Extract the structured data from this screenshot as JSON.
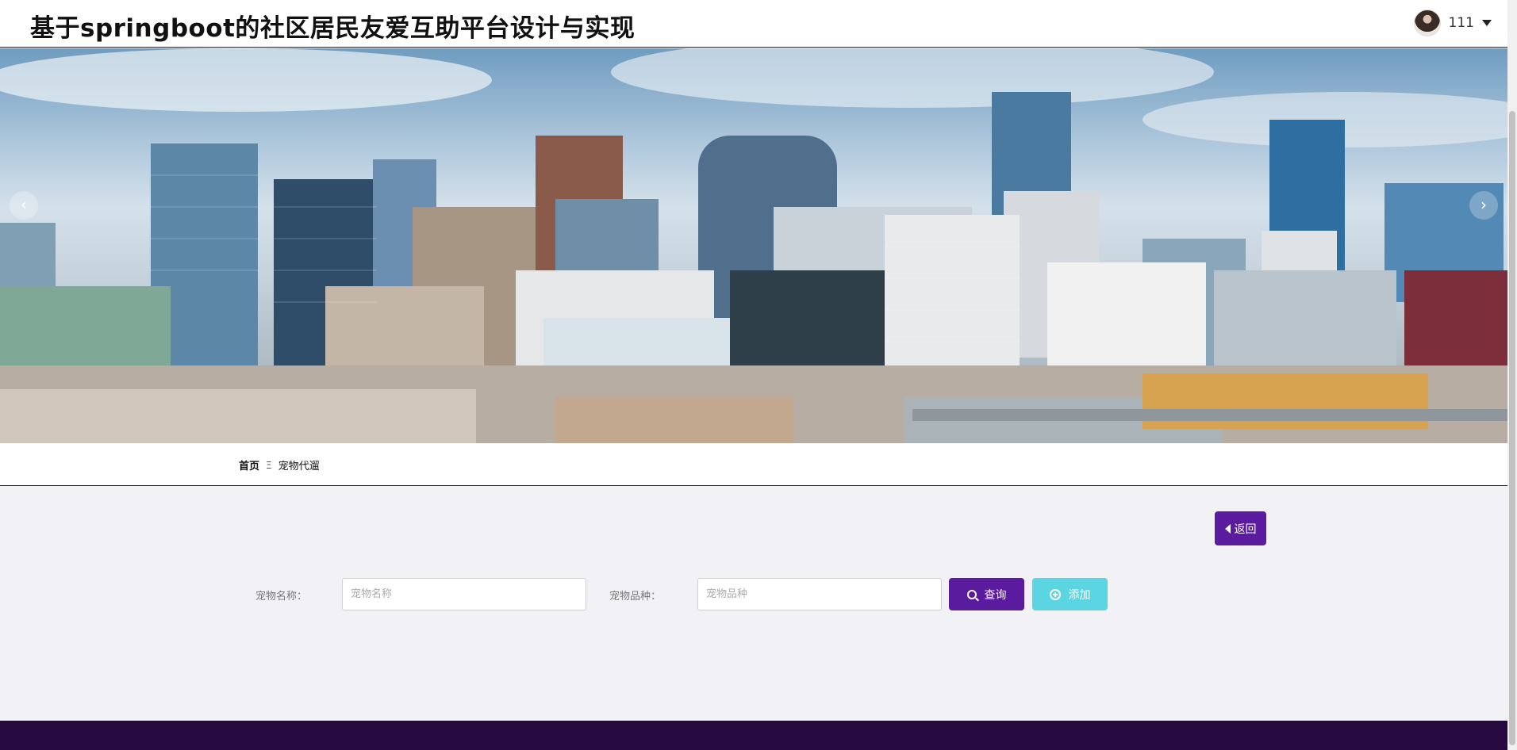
{
  "header": {
    "title": "基于springboot的社区居民友爱互助平台设计与实现",
    "username": "111"
  },
  "banner": {
    "prev_label": "‹",
    "next_label": "›"
  },
  "breadcrumb": {
    "home": "首页",
    "separator": "Ξ",
    "current": "宠物代遛"
  },
  "actions": {
    "back_label": "返回"
  },
  "search": {
    "name_label": "宠物名称：",
    "name_placeholder": "宠物名称",
    "breed_label": "宠物品种：",
    "breed_placeholder": "宠物品种",
    "query_label": "查询",
    "add_label": "添加"
  },
  "colors": {
    "primary": "#5a1b9e",
    "add_button": "#5bd5e2",
    "footer": "#26093f"
  }
}
